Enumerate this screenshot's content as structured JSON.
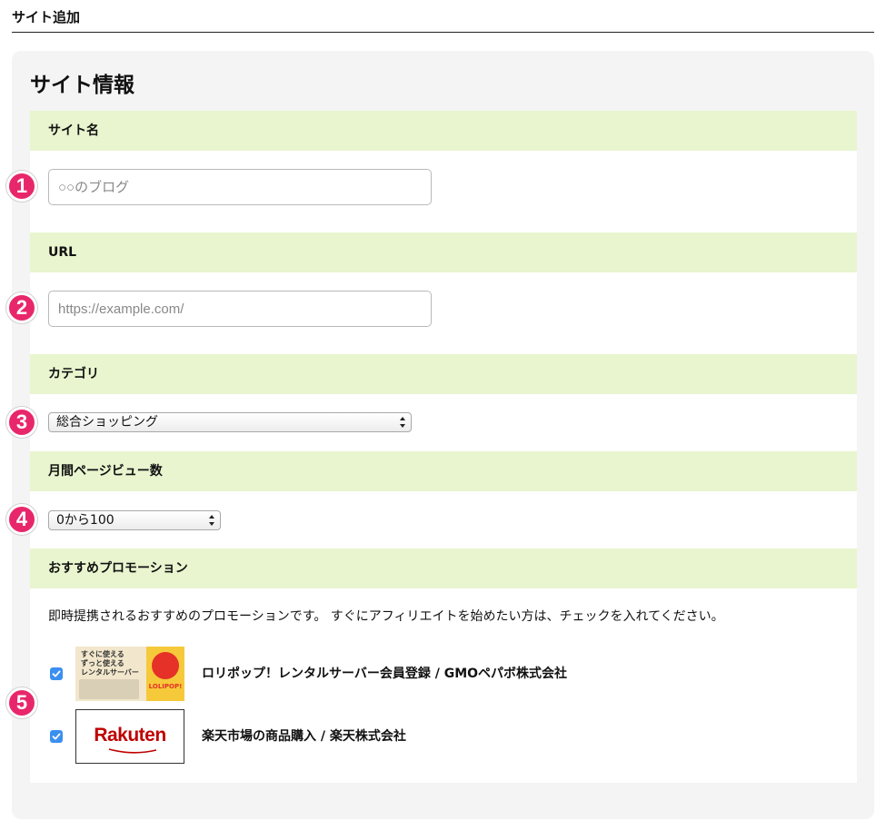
{
  "page": {
    "title": "サイト追加"
  },
  "card": {
    "title": "サイト情報"
  },
  "sections": {
    "site_name": {
      "label": "サイト名",
      "placeholder": "○○のブログ"
    },
    "url": {
      "label": "URL",
      "placeholder": "https://example.com/"
    },
    "category": {
      "label": "カテゴリ",
      "selected": "総合ショッピング"
    },
    "pageviews": {
      "label": "月間ページビュー数",
      "selected": "0から100"
    },
    "promotion": {
      "label": "おすすめプロモーション",
      "description": "即時提携されるおすすめのプロモーションです。 すぐにアフィリエイトを始めたい方は、チェックを入れてください。",
      "items": [
        {
          "label": "ロリポップ！レンタルサーバー会員登録 / GMOペパボ株式会社",
          "checked": true,
          "banner_text": "すぐに使える\nずっと使える\nレンタルサーバー",
          "banner_logo": "LOLIPOP!"
        },
        {
          "label": "楽天市場の商品購入 / 楽天株式会社",
          "checked": true,
          "banner_logo": "Rakuten"
        }
      ]
    }
  },
  "badges": [
    "1",
    "2",
    "3",
    "4",
    "5"
  ],
  "colors": {
    "section_header_bg": "#e8f5cf",
    "card_bg": "#f4f4f4",
    "badge": "#e8276b",
    "checkbox": "#3b8ff0",
    "rakuten_red": "#bf0000",
    "lolipop_yellow": "#f6c93a"
  },
  "icons": {
    "select": "updown-arrows-icon",
    "checkbox": "checkmark-icon"
  }
}
